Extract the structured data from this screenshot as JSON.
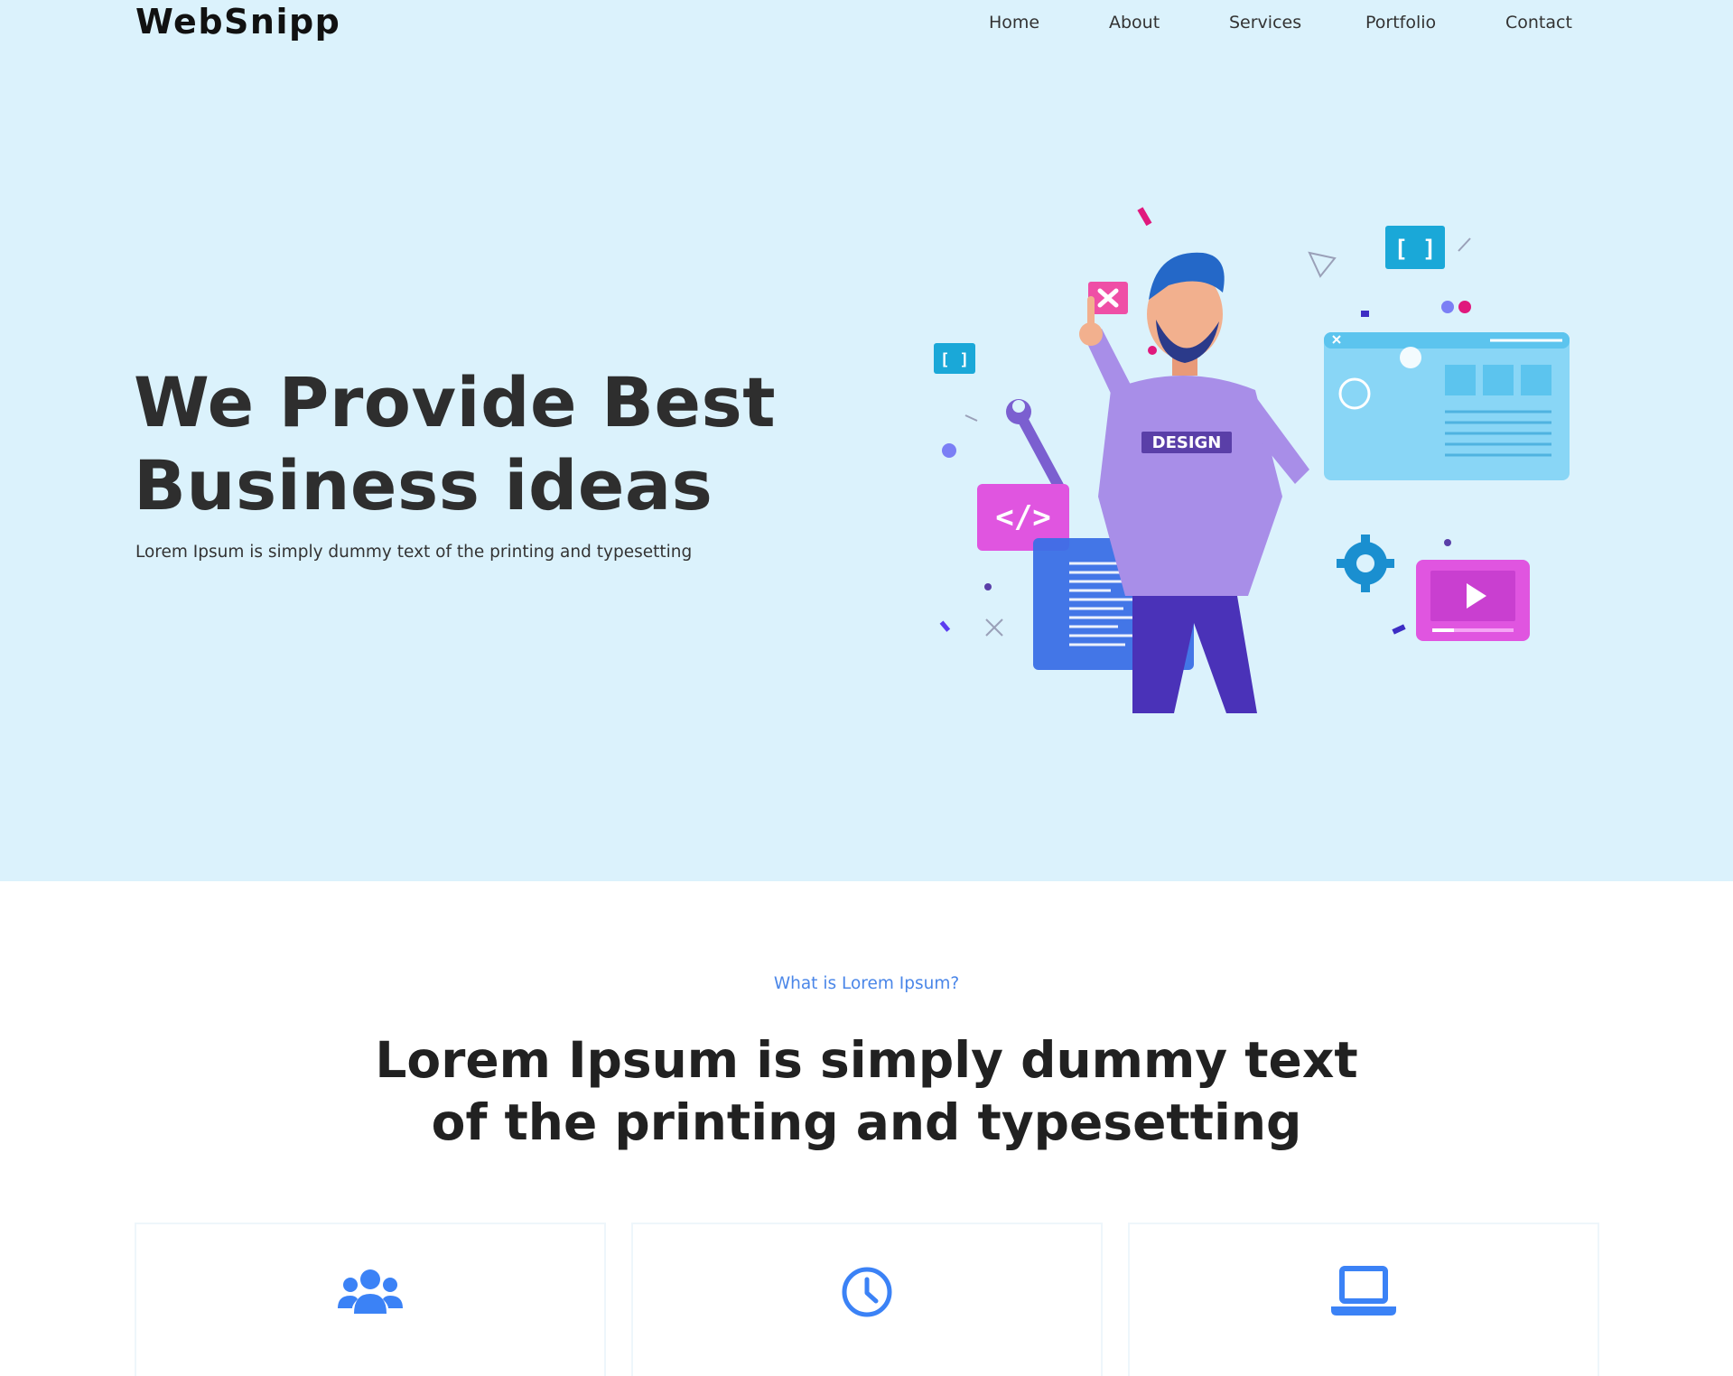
{
  "brand": {
    "logo_text": "WebSnipp"
  },
  "nav": {
    "items": [
      "Home",
      "About",
      "Services",
      "Portfolio",
      "Contact"
    ]
  },
  "hero": {
    "title_line1": "We Provide Best",
    "title_line2": "Business ideas",
    "subtitle": "Lorem Ipsum is simply dummy text of the printing and typesetting",
    "illustration_labels": {
      "shirt": "DESIGN",
      "code_tag": "</>",
      "brackets": "[ ]"
    }
  },
  "features": {
    "eyebrow": "What is Lorem Ipsum?",
    "title_line1": "Lorem Ipsum is simply dummy text",
    "title_line2": "of the printing and typesetting",
    "cards": [
      {
        "icon": "users-icon"
      },
      {
        "icon": "clock-icon"
      },
      {
        "icon": "laptop-icon"
      }
    ]
  },
  "colors": {
    "hero_bg": "#dbf2fc",
    "accent": "#4a86e8",
    "heading": "#2e2e2e",
    "icon_blue": "#3b82f6"
  }
}
